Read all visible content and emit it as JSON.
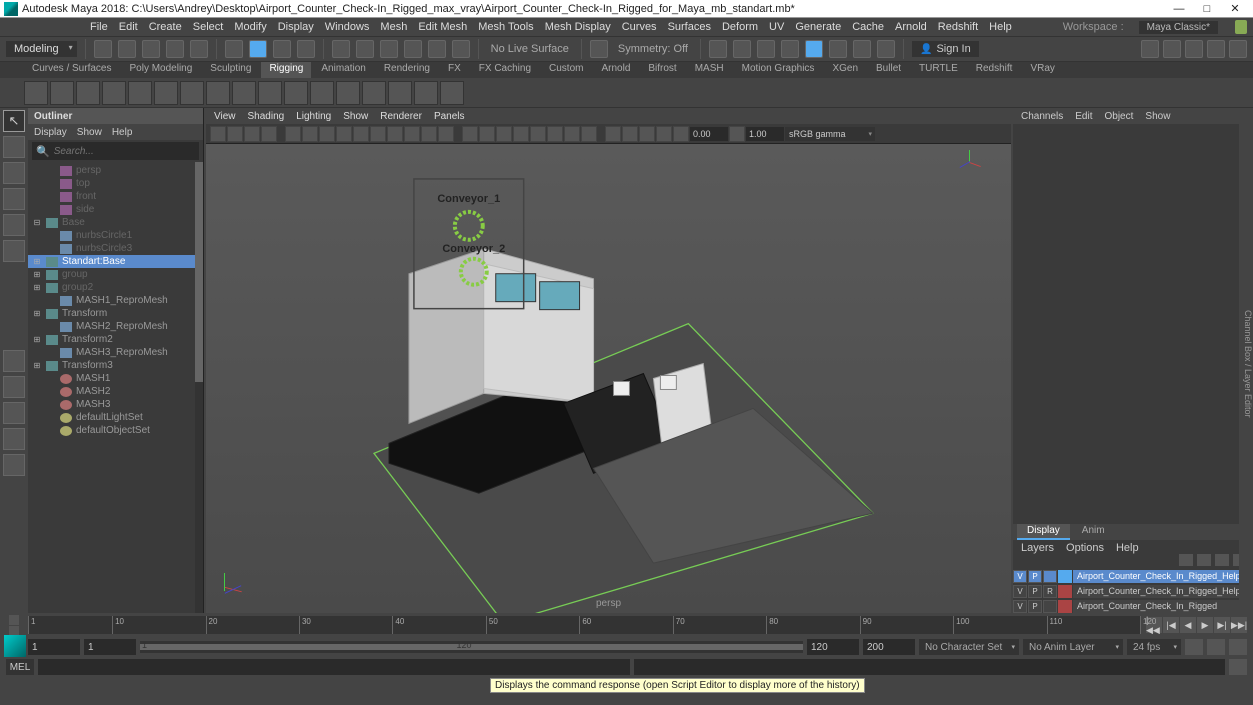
{
  "title": "Autodesk Maya 2018: C:\\Users\\Andrey\\Desktop\\Airport_Counter_Check-In_Rigged_max_vray\\Airport_Counter_Check-In_Rigged_for_Maya_mb_standart.mb*",
  "workspace_label": "Workspace :",
  "workspace_value": "Maya Classic*",
  "menus": [
    "File",
    "Edit",
    "Create",
    "Select",
    "Modify",
    "Display",
    "Windows",
    "Mesh",
    "Edit Mesh",
    "Mesh Tools",
    "Mesh Display",
    "Curves",
    "Surfaces",
    "Deform",
    "UV",
    "Generate",
    "Cache",
    "Arnold",
    "Redshift",
    "Help"
  ],
  "mode_dd": "Modeling",
  "no_live": "No Live Surface",
  "symmetry": "Symmetry: Off",
  "signin": "Sign In",
  "shelf_tabs": [
    "Curves / Surfaces",
    "Poly Modeling",
    "Sculpting",
    "Rigging",
    "Animation",
    "Rendering",
    "FX",
    "FX Caching",
    "Custom",
    "Arnold",
    "Bifrost",
    "MASH",
    "Motion Graphics",
    "XGen",
    "Bullet",
    "TURTLE",
    "Redshift",
    "VRay"
  ],
  "shelf_active": 3,
  "outliner": {
    "title": "Outliner",
    "menus": [
      "Display",
      "Show",
      "Help"
    ],
    "search_ph": "Search...",
    "items": [
      {
        "exp": "",
        "ico": "cam",
        "lbl": "persp",
        "dim": true,
        "ind": 1
      },
      {
        "exp": "",
        "ico": "cam",
        "lbl": "top",
        "dim": true,
        "ind": 1
      },
      {
        "exp": "",
        "ico": "cam",
        "lbl": "front",
        "dim": true,
        "ind": 1
      },
      {
        "exp": "",
        "ico": "cam",
        "lbl": "side",
        "dim": true,
        "ind": 1
      },
      {
        "exp": "⊟",
        "ico": "grp",
        "lbl": "Base",
        "dim": true,
        "ind": 0
      },
      {
        "exp": "",
        "ico": "mesh",
        "lbl": "nurbsCircle1",
        "dim": true,
        "ind": 1
      },
      {
        "exp": "",
        "ico": "mesh",
        "lbl": "nurbsCircle3",
        "dim": true,
        "ind": 1
      },
      {
        "exp": "⊞",
        "ico": "grp",
        "lbl": "Standart:Base",
        "dim": false,
        "ind": 0,
        "sel": true
      },
      {
        "exp": "⊞",
        "ico": "grp",
        "lbl": "group",
        "dim": true,
        "ind": 0
      },
      {
        "exp": "⊞",
        "ico": "grp",
        "lbl": "group2",
        "dim": true,
        "ind": 0
      },
      {
        "exp": "",
        "ico": "mesh",
        "lbl": "MASH1_ReproMesh",
        "dim": false,
        "ind": 1
      },
      {
        "exp": "⊞",
        "ico": "grp",
        "lbl": "Transform",
        "dim": false,
        "ind": 0
      },
      {
        "exp": "",
        "ico": "mesh",
        "lbl": "MASH2_ReproMesh",
        "dim": false,
        "ind": 1
      },
      {
        "exp": "⊞",
        "ico": "grp",
        "lbl": "Transform2",
        "dim": false,
        "ind": 0
      },
      {
        "exp": "",
        "ico": "mesh",
        "lbl": "MASH3_ReproMesh",
        "dim": false,
        "ind": 1
      },
      {
        "exp": "⊞",
        "ico": "grp",
        "lbl": "Transform3",
        "dim": false,
        "ind": 0
      },
      {
        "exp": "",
        "ico": "mash",
        "lbl": "MASH1",
        "dim": false,
        "ind": 1
      },
      {
        "exp": "",
        "ico": "mash",
        "lbl": "MASH2",
        "dim": false,
        "ind": 1
      },
      {
        "exp": "",
        "ico": "mash",
        "lbl": "MASH3",
        "dim": false,
        "ind": 1
      },
      {
        "exp": "",
        "ico": "set",
        "lbl": "defaultLightSet",
        "dim": false,
        "ind": 1
      },
      {
        "exp": "",
        "ico": "set",
        "lbl": "defaultObjectSet",
        "dim": false,
        "ind": 1
      }
    ]
  },
  "viewport": {
    "menus": [
      "View",
      "Shading",
      "Lighting",
      "Show",
      "Renderer",
      "Panels"
    ],
    "num1": "0.00",
    "num2": "1.00",
    "dd": "sRGB gamma",
    "camera": "persp",
    "annot1": "Conveyor_1",
    "annot2": "Conveyor_2"
  },
  "rightpanel": {
    "menus": [
      "Channels",
      "Edit",
      "Object",
      "Show"
    ],
    "tabs": [
      "Display",
      "Anim"
    ],
    "tab_active": 0,
    "menus2": [
      "Layers",
      "Options",
      "Help"
    ],
    "layers": [
      {
        "v": "V",
        "p": "P",
        "r": "",
        "color": "#5ae",
        "name": "Airport_Counter_Check_In_Rigged_Helpers",
        "sel": true
      },
      {
        "v": "V",
        "p": "P",
        "r": "R",
        "color": "#a44",
        "name": "Airport_Counter_Check_In_Rigged_Helpers_Freeze"
      },
      {
        "v": "V",
        "p": "P",
        "r": "",
        "color": "#a44",
        "name": "Airport_Counter_Check_In_Rigged"
      }
    ]
  },
  "rightbar": "Channel Box / Layer Editor",
  "timeline": {
    "ticks": [
      1,
      10,
      20,
      30,
      40,
      50,
      60,
      70,
      80,
      90,
      100,
      110,
      120
    ],
    "start": "1",
    "start2": "1",
    "range_start": "1",
    "range_end": "120",
    "end": "120",
    "end2": "200",
    "charset": "No Character Set",
    "animlayer": "No Anim Layer",
    "fps": "24 fps"
  },
  "cmd_label": "MEL",
  "tooltip": "Displays the command response (open Script Editor to display more of the history)"
}
